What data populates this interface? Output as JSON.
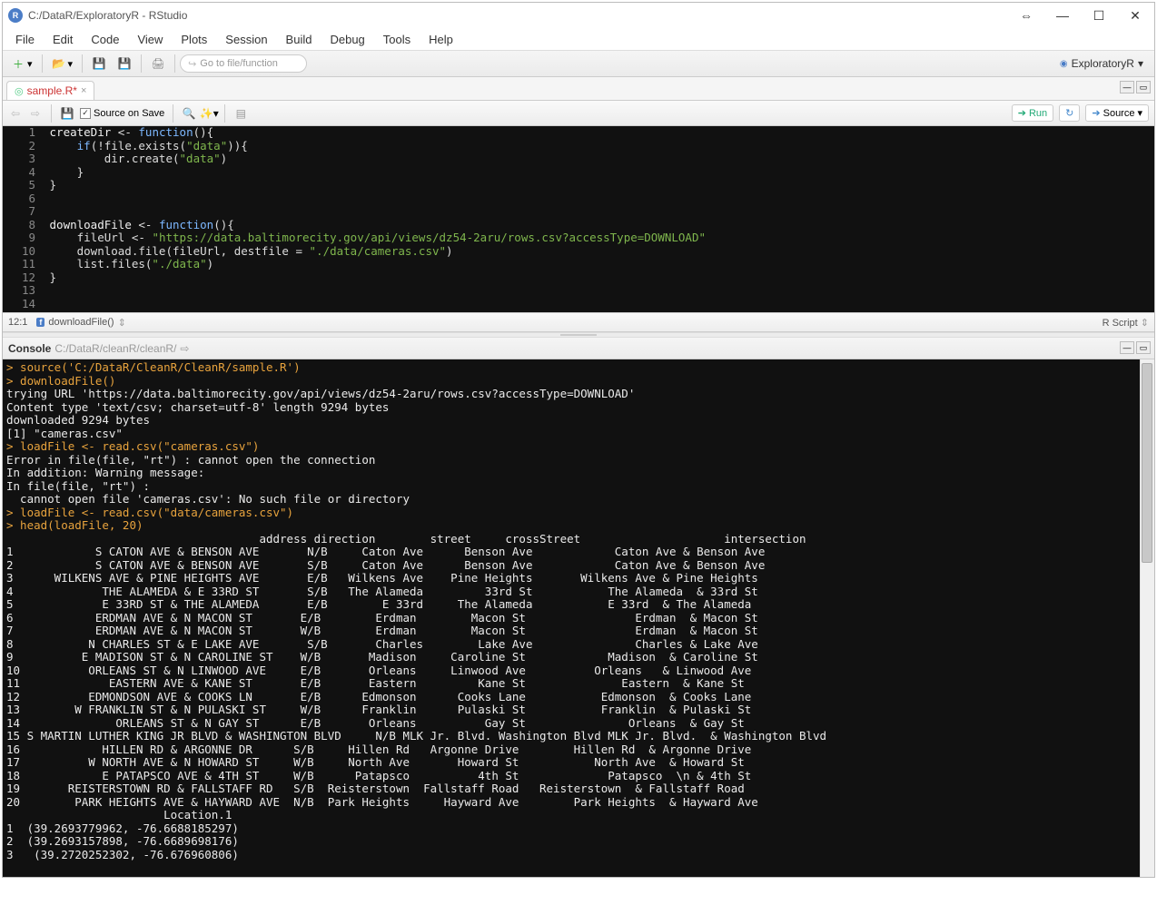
{
  "window": {
    "title": "C:/DataR/ExploratoryR - RStudio",
    "min": "—",
    "max": "☐",
    "close": "✕",
    "resize": "⇔"
  },
  "menu": [
    "File",
    "Edit",
    "Code",
    "View",
    "Plots",
    "Session",
    "Build",
    "Debug",
    "Tools",
    "Help"
  ],
  "toolbar": {
    "goto_placeholder": "Go to file/function",
    "project": "ExploratoryR"
  },
  "tab": {
    "label": "sample.R*"
  },
  "editor_toolbar": {
    "source_on_save": "Source on Save",
    "run": "Run",
    "source": "Source"
  },
  "code": {
    "lines": [
      {
        "n": "1",
        "html": "<span class='kw-name'>createDir</span> <span class='kw-assign'>&lt;-</span> <span class='kw-func'>function</span>(){"
      },
      {
        "n": "2",
        "html": "    <span class='kw-if'>if</span>(!file.exists(<span class='kw-str'>\"data\"</span>)){"
      },
      {
        "n": "3",
        "html": "        dir.create(<span class='kw-str'>\"data\"</span>)"
      },
      {
        "n": "4",
        "html": "    }"
      },
      {
        "n": "5",
        "html": "}"
      },
      {
        "n": "6",
        "html": ""
      },
      {
        "n": "7",
        "html": ""
      },
      {
        "n": "8",
        "html": "<span class='kw-name'>downloadFile</span> <span class='kw-assign'>&lt;-</span> <span class='kw-func'>function</span>(){"
      },
      {
        "n": "9",
        "html": "    fileUrl <span class='kw-assign'>&lt;-</span> <span class='kw-str'>\"https://data.baltimorecity.gov/api/views/dz54-2aru/rows.csv?accessType=DOWNLOAD\"</span>"
      },
      {
        "n": "10",
        "html": "    download.file(fileUrl, destfile <span class='kw-assign'>=</span> <span class='kw-str'>\"./data/cameras.csv\"</span>)"
      },
      {
        "n": "11",
        "html": "    list.files(<span class='kw-str'>\"./data\"</span>)"
      },
      {
        "n": "12",
        "html": "}"
      },
      {
        "n": "13",
        "html": ""
      },
      {
        "n": "14",
        "html": ""
      }
    ]
  },
  "editor_status": {
    "pos": "12:1",
    "fn": "downloadFile()",
    "mode": "R Script"
  },
  "console_header": {
    "label": "Console",
    "path": "C:/DataR/cleanR/cleanR/"
  },
  "console": {
    "lines": [
      {
        "cls": "c-prompt",
        "text": "> source('C:/DataR/CleanR/CleanR/sample.R')"
      },
      {
        "cls": "c-prompt",
        "text": "> downloadFile()"
      },
      {
        "cls": "c-output",
        "text": "trying URL 'https://data.baltimorecity.gov/api/views/dz54-2aru/rows.csv?accessType=DOWNLOAD'"
      },
      {
        "cls": "c-output",
        "text": "Content type 'text/csv; charset=utf-8' length 9294 bytes"
      },
      {
        "cls": "c-output",
        "text": "downloaded 9294 bytes"
      },
      {
        "cls": "c-output",
        "text": ""
      },
      {
        "cls": "c-output",
        "text": "[1] \"cameras.csv\""
      },
      {
        "cls": "c-prompt",
        "text": "> loadFile <- read.csv(\"cameras.csv\")"
      },
      {
        "cls": "c-output",
        "text": "Error in file(file, \"rt\") : cannot open the connection"
      },
      {
        "cls": "c-output",
        "text": "In addition: Warning message:"
      },
      {
        "cls": "c-output",
        "text": "In file(file, \"rt\") :"
      },
      {
        "cls": "c-output",
        "text": "  cannot open file 'cameras.csv': No such file or directory"
      },
      {
        "cls": "c-prompt",
        "text": "> loadFile <- read.csv(\"data/cameras.csv\")"
      },
      {
        "cls": "c-prompt",
        "text": "> head(loadFile, 20)"
      },
      {
        "cls": "c-head",
        "text": "                                     address direction        street     crossStreet                     intersection"
      },
      {
        "cls": "c-output",
        "text": "1            S CATON AVE & BENSON AVE       N/B     Caton Ave      Benson Ave            Caton Ave & Benson Ave"
      },
      {
        "cls": "c-output",
        "text": "2            S CATON AVE & BENSON AVE       S/B     Caton Ave      Benson Ave            Caton Ave & Benson Ave"
      },
      {
        "cls": "c-output",
        "text": "3      WILKENS AVE & PINE HEIGHTS AVE       E/B   Wilkens Ave    Pine Heights       Wilkens Ave & Pine Heights"
      },
      {
        "cls": "c-output",
        "text": "4             THE ALAMEDA & E 33RD ST       S/B   The Alameda         33rd St           The Alameda  & 33rd St"
      },
      {
        "cls": "c-output",
        "text": "5             E 33RD ST & THE ALAMEDA       E/B        E 33rd     The Alameda           E 33rd  & The Alameda"
      },
      {
        "cls": "c-output",
        "text": "6            ERDMAN AVE & N MACON ST       E/B        Erdman        Macon St                Erdman  & Macon St"
      },
      {
        "cls": "c-output",
        "text": "7            ERDMAN AVE & N MACON ST       W/B        Erdman        Macon St                Erdman  & Macon St"
      },
      {
        "cls": "c-output",
        "text": "8           N CHARLES ST & E LAKE AVE       S/B       Charles        Lake Ave               Charles & Lake Ave"
      },
      {
        "cls": "c-output",
        "text": "9          E MADISON ST & N CAROLINE ST    W/B       Madison     Caroline St            Madison  & Caroline St"
      },
      {
        "cls": "c-output",
        "text": "10          ORLEANS ST & N LINWOOD AVE     E/B       Orleans     Linwood Ave          Orleans   & Linwood Ave"
      },
      {
        "cls": "c-output",
        "text": "11             EASTERN AVE & KANE ST       E/B       Eastern         Kane St              Eastern  & Kane St"
      },
      {
        "cls": "c-output",
        "text": "12          EDMONDSON AVE & COOKS LN       E/B      Edmonson      Cooks Lane           Edmonson  & Cooks Lane"
      },
      {
        "cls": "c-output",
        "text": "13        W FRANKLIN ST & N PULASKI ST     W/B      Franklin      Pulaski St           Franklin  & Pulaski St"
      },
      {
        "cls": "c-output",
        "text": "14              ORLEANS ST & N GAY ST      E/B       Orleans          Gay St               Orleans  & Gay St"
      },
      {
        "cls": "c-output",
        "text": "15 S MARTIN LUTHER KING JR BLVD & WASHINGTON BLVD     N/B MLK Jr. Blvd. Washington Blvd MLK Jr. Blvd.  & Washington Blvd"
      },
      {
        "cls": "c-output",
        "text": "16            HILLEN RD & ARGONNE DR      S/B     Hillen Rd   Argonne Drive        Hillen Rd  & Argonne Drive"
      },
      {
        "cls": "c-output",
        "text": "17          W NORTH AVE & N HOWARD ST     W/B     North Ave       Howard St           North Ave  & Howard St"
      },
      {
        "cls": "c-output",
        "text": "18            E PATAPSCO AVE & 4TH ST     W/B      Patapsco          4th St             Patapsco  \\n & 4th St"
      },
      {
        "cls": "c-output",
        "text": "19       REISTERSTOWN RD & FALLSTAFF RD   S/B  Reisterstown  Fallstaff Road   Reisterstown  & Fallstaff Road"
      },
      {
        "cls": "c-output",
        "text": "20        PARK HEIGHTS AVE & HAYWARD AVE  N/B  Park Heights     Hayward Ave        Park Heights  & Hayward Ave"
      },
      {
        "cls": "c-head",
        "text": "                       Location.1"
      },
      {
        "cls": "c-output",
        "text": "1  (39.2693779962, -76.6688185297)"
      },
      {
        "cls": "c-output",
        "text": "2  (39.2693157898, -76.6689698176)"
      },
      {
        "cls": "c-output",
        "text": "3   (39.2720252302, -76.676960806)"
      }
    ]
  }
}
